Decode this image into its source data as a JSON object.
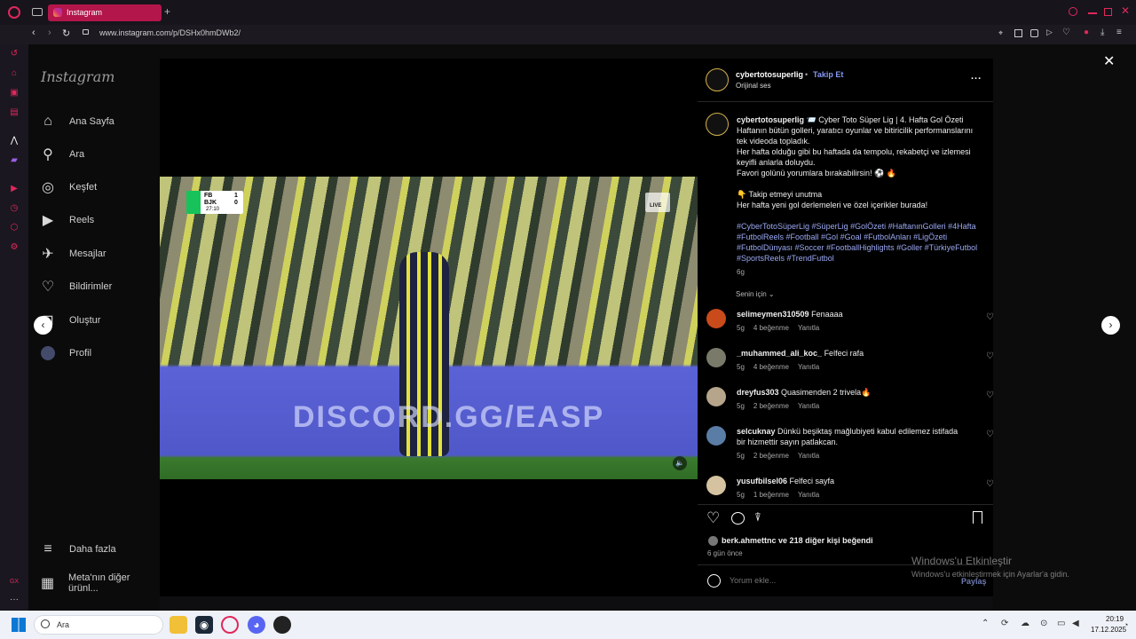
{
  "browser": {
    "tab_title": "Instagram",
    "new_tab": "+",
    "url": "www.instagram.com/p/DSHx0hmDWb2/"
  },
  "sidebar": {
    "logo": "Instagram",
    "items": [
      {
        "label": "Ana Sayfa",
        "icon": "home-icon"
      },
      {
        "label": "Ara",
        "icon": "search-icon"
      },
      {
        "label": "Keşfet",
        "icon": "compass-icon"
      },
      {
        "label": "Reels",
        "icon": "reels-icon"
      },
      {
        "label": "Mesajlar",
        "icon": "messenger-icon"
      },
      {
        "label": "Bildirimler",
        "icon": "heart-icon"
      },
      {
        "label": "Oluştur",
        "icon": "plus-square-icon"
      },
      {
        "label": "Profil",
        "icon": "profile-avatar"
      }
    ],
    "more": "Daha fazla",
    "meta": "Meta'nın diğer ürünl..."
  },
  "video": {
    "score_home": "FB",
    "score_away": "BJK",
    "score_home_val": "1",
    "score_away_val": "0",
    "time": "27:10",
    "live": "LIVE",
    "banner": "DISCORD.GG/EASP"
  },
  "post": {
    "author": "cybertotosuperlig",
    "separator": "•",
    "follow": "Takip Et",
    "audio": "Orijinal ses",
    "more": "...",
    "caption_title": "📨 Cyber Toto Süper Lig | 4. Hafta Gol Özeti",
    "caption_lines": [
      "Haftanın bütün golleri, yaratıcı oyunlar ve bitiricilik performanslarını",
      "tek videoda topladık.",
      "Her hafta olduğu gibi bu haftada da tempolu, rekabetçi ve izlemesi",
      "keyifli anlarla doluydu.",
      "Favori golünü yorumlara bırakabilirsin! ⚽ 🔥"
    ],
    "caption_follow": "👇 Takip etmeyi unutma",
    "caption_follow2": "Her hafta yeni gol derlemeleri ve özel içerikler burada!",
    "hashtags": [
      "#CyberTotoSüperLig #SüperLig #GolÖzeti #HaftanınGolleri #4Hafta",
      "#FutbolReels #Football #Gol #Goal #FutbolAnları #LigÖzeti",
      "#FutbolDünyası #Soccer #FootballHighlights #Goller #TürkiyeFutbol",
      "#SportsReels #TrendFutbol"
    ],
    "age": "6g",
    "filter": "Senin için",
    "likes_user": "berk.ahmettnc",
    "likes_rest": "ve 218 diğer kişi beğendi",
    "date": "6 gün önce",
    "comment_placeholder": "Yorum ekle...",
    "share": "Paylaş"
  },
  "comments": [
    {
      "user": "selimeymen310509",
      "text": "Fenaaaa",
      "age": "5g",
      "likes": "4 beğenme",
      "reply": "Yanıtla",
      "color": "#c94a1a"
    },
    {
      "user": "_muhammed_ali_koc_",
      "text": "Felfeci rafa",
      "age": "5g",
      "likes": "4 beğenme",
      "reply": "Yanıtla",
      "color": "#7a7a6a"
    },
    {
      "user": "dreyfus303",
      "text": "Quasimenden 2 trivela🔥",
      "age": "5g",
      "likes": "2 beğenme",
      "reply": "Yanıtla",
      "color": "#b6a58a"
    },
    {
      "user": "selcuknay",
      "text": "Dünkü beşiktaş mağlubiyeti kabul edilemez istifada",
      "text2": "bir hizmettir sayın patlakcan.",
      "age": "5g",
      "likes": "2 beğenme",
      "reply": "Yanıtla",
      "color": "#5a7da6"
    },
    {
      "user": "yusufbilsel06",
      "text": "Felfeci sayfa",
      "age": "5g",
      "likes": "1 beğenme",
      "reply": "Yanıtla",
      "color": "#d4c2a0"
    }
  ],
  "watermark": {
    "line1": "Windows'u Etkinleştir",
    "line2": "Windows'u etkinleştirmek için Ayarlar'a gidin."
  },
  "taskbar": {
    "search": "Ara",
    "time": "20:19",
    "date": "17.12.2025"
  }
}
